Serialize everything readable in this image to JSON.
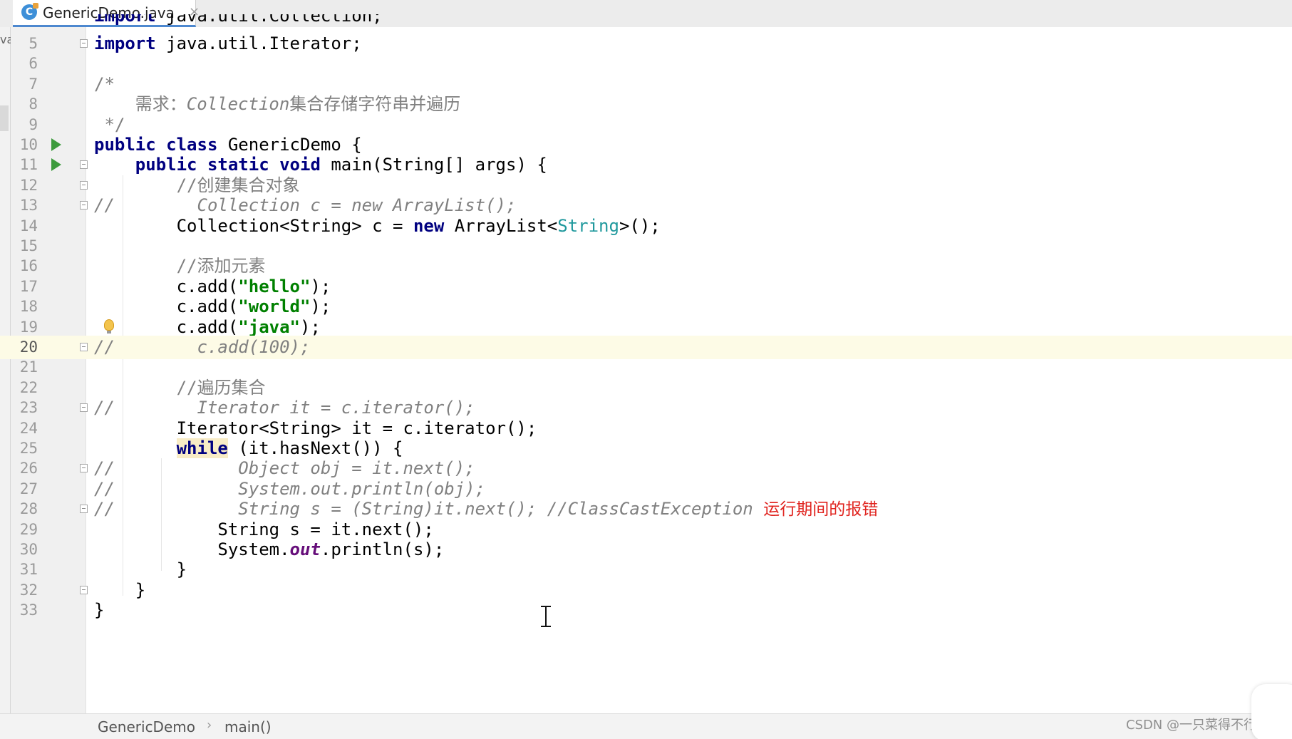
{
  "editor_tab": {
    "icon": "java-class-icon",
    "filename": "GenericDemo.java",
    "close_glyph": "×"
  },
  "left_panel_sliver": "va",
  "code": {
    "partial_top_line": "import java.util.Collection;",
    "lines": [
      {
        "no": "5",
        "text": "import java.util.Iterator;"
      },
      {
        "no": "6",
        "text": ""
      },
      {
        "no": "7",
        "text": "/*"
      },
      {
        "no": "8",
        "text": "    需求：Collection集合存储字符串并遍历"
      },
      {
        "no": "9",
        "text": " */"
      },
      {
        "no": "10",
        "text": "public class GenericDemo {"
      },
      {
        "no": "11",
        "text": "    public static void main(String[] args) {"
      },
      {
        "no": "12",
        "text": "        //创建集合对象"
      },
      {
        "no": "13",
        "text": "//        Collection c = new ArrayList();"
      },
      {
        "no": "14",
        "text": "        Collection<String> c = new ArrayList<String>();"
      },
      {
        "no": "15",
        "text": ""
      },
      {
        "no": "16",
        "text": "        //添加元素"
      },
      {
        "no": "17",
        "text": "        c.add(\"hello\");"
      },
      {
        "no": "18",
        "text": "        c.add(\"world\");"
      },
      {
        "no": "19",
        "text": "        c.add(\"java\");"
      },
      {
        "no": "20",
        "text": "//        c.add(100);"
      },
      {
        "no": "21",
        "text": ""
      },
      {
        "no": "22",
        "text": "        //遍历集合"
      },
      {
        "no": "23",
        "text": "//        Iterator it = c.iterator();"
      },
      {
        "no": "24",
        "text": "        Iterator<String> it = c.iterator();"
      },
      {
        "no": "25",
        "text": "        while (it.hasNext()) {"
      },
      {
        "no": "26",
        "text": "//            Object obj = it.next();"
      },
      {
        "no": "27",
        "text": "//            System.out.println(obj);"
      },
      {
        "no": "28",
        "text": "//            String s = (String)it.next(); //ClassCastException 运行期间的报错"
      },
      {
        "no": "29",
        "text": "            String s = it.next();"
      },
      {
        "no": "30",
        "text": "            System.out.println(s);"
      },
      {
        "no": "31",
        "text": "        }"
      },
      {
        "no": "32",
        "text": "    }"
      },
      {
        "no": "33",
        "text": "}"
      }
    ],
    "current_line": "20",
    "annotation_note": "运行期间的报错"
  },
  "breadcrumb": {
    "items": [
      "GenericDemo",
      "main()"
    ],
    "separator": "›"
  },
  "watermark": "CSDN @一只菜得不行的鸟",
  "colors": {
    "keyword": "#000080",
    "string": "#008000",
    "comment": "#808080",
    "static_field": "#660e7a",
    "type_param": "#20999d",
    "note_red": "#e0241f",
    "current_line_bg": "#fdfbe6",
    "tab_underline": "#4d88cf"
  }
}
